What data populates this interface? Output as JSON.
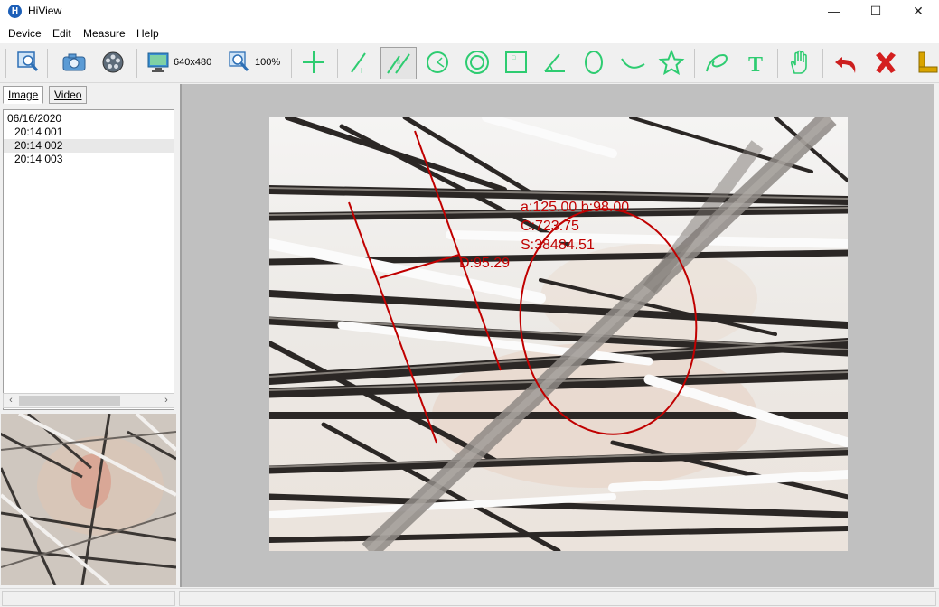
{
  "window": {
    "title": "HiView",
    "icon_letter": "H",
    "controls": {
      "minimize": "—",
      "maximize": "☐",
      "close": "✕"
    }
  },
  "menu": [
    "Device",
    "Edit",
    "Measure",
    "Help"
  ],
  "toolbar": {
    "resolution_label": "640x480",
    "zoom_label": "100%",
    "icons": [
      "preview-icon",
      "camera-icon",
      "video-reel-icon",
      "resolution-monitor-icon",
      "zoom-icon",
      "crosshair-icon",
      "line-icon",
      "parallel-lines-icon",
      "angle-circle-icon",
      "concentric-circle-icon",
      "rectangle-icon",
      "angle-icon",
      "ellipse-icon",
      "arc-icon",
      "polygon-icon",
      "freehand-icon",
      "text-icon",
      "hand-icon",
      "undo-icon",
      "delete-icon",
      "calibrate-ruler-icon"
    ],
    "colors": {
      "tool_green": "#2ecc71",
      "undo_red": "#cc1f1f",
      "delete_red": "#d41f1f",
      "ruler_yellow": "#d9a400"
    }
  },
  "left_panel": {
    "tabs": [
      "Image",
      "Video"
    ],
    "active_tab": "Image",
    "tree": {
      "date": "06/16/2020",
      "items": [
        "20:14 001",
        "20:14 002",
        "20:14 003"
      ],
      "selected_index": 1
    }
  },
  "measurements": {
    "distance_label": "D:95.29",
    "ellipse_axes": "a:125.00 b:98.00",
    "ellipse_circumference": "C:723.75",
    "ellipse_area": "S:38484.51",
    "annotation_color": "#c00000"
  }
}
